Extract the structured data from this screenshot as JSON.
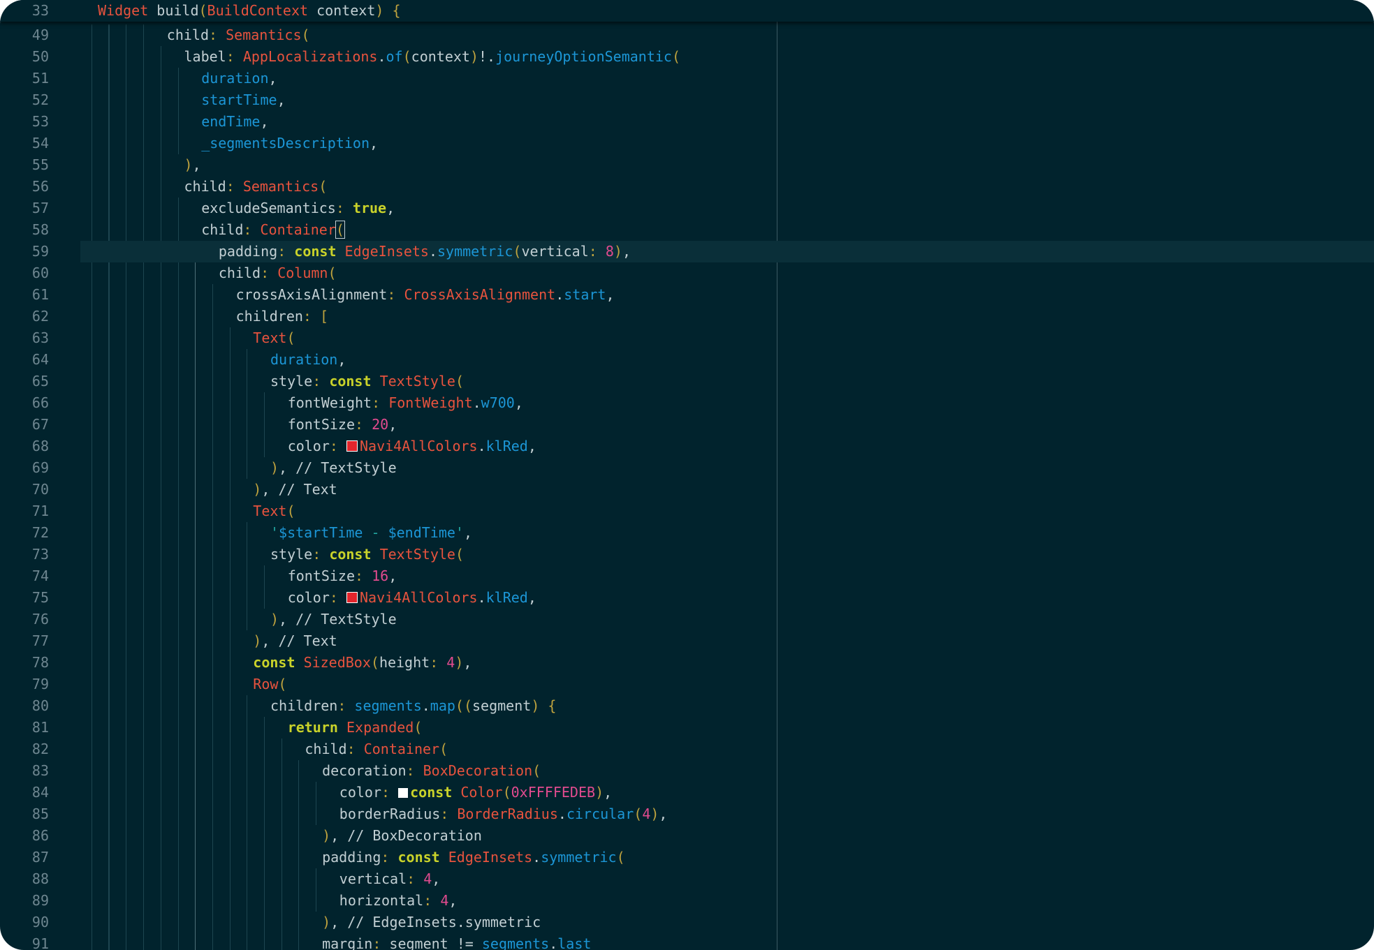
{
  "sticky_line": {
    "number": "33",
    "text": "Widget build(BuildContext context) {"
  },
  "lines": [
    {
      "n": "49",
      "text": "child: Semantics("
    },
    {
      "n": "50",
      "text": "label: AppLocalizations.of(context)!.journeyOptionSemantic("
    },
    {
      "n": "51",
      "text": "duration,"
    },
    {
      "n": "52",
      "text": "startTime,"
    },
    {
      "n": "53",
      "text": "endTime,"
    },
    {
      "n": "54",
      "text": "_segmentsDescription,"
    },
    {
      "n": "55",
      "text": "),"
    },
    {
      "n": "56",
      "text": "child: Semantics("
    },
    {
      "n": "57",
      "text": "excludeSemantics: true,"
    },
    {
      "n": "58",
      "text": "child: Container("
    },
    {
      "n": "59",
      "text": "padding: const EdgeInsets.symmetric(vertical: 8),"
    },
    {
      "n": "60",
      "text": "child: Column("
    },
    {
      "n": "61",
      "text": "crossAxisAlignment: CrossAxisAlignment.start,"
    },
    {
      "n": "62",
      "text": "children: ["
    },
    {
      "n": "63",
      "text": "Text("
    },
    {
      "n": "64",
      "text": "duration,"
    },
    {
      "n": "65",
      "text": "style: const TextStyle("
    },
    {
      "n": "66",
      "text": "fontWeight: FontWeight.w700,"
    },
    {
      "n": "67",
      "text": "fontSize: 20,"
    },
    {
      "n": "68",
      "text": "color: Navi4AllColors.klRed,"
    },
    {
      "n": "69",
      "text": "), // TextStyle"
    },
    {
      "n": "70",
      "text": "), // Text"
    },
    {
      "n": "71",
      "text": "Text("
    },
    {
      "n": "72",
      "text": "'$startTime - $endTime',"
    },
    {
      "n": "73",
      "text": "style: const TextStyle("
    },
    {
      "n": "74",
      "text": "fontSize: 16,"
    },
    {
      "n": "75",
      "text": "color: Navi4AllColors.klRed,"
    },
    {
      "n": "76",
      "text": "), // TextStyle"
    },
    {
      "n": "77",
      "text": "), // Text"
    },
    {
      "n": "78",
      "text": "const SizedBox(height: 4),"
    },
    {
      "n": "79",
      "text": "Row("
    },
    {
      "n": "80",
      "text": "children: segments.map((segment) {"
    },
    {
      "n": "81",
      "text": "return Expanded("
    },
    {
      "n": "82",
      "text": "child: Container("
    },
    {
      "n": "83",
      "text": "decoration: BoxDecoration("
    },
    {
      "n": "84",
      "text": "color: const Color(0xFFFFEDEB),"
    },
    {
      "n": "85",
      "text": "borderRadius: BorderRadius.circular(4),"
    },
    {
      "n": "86",
      "text": "), // BoxDecoration"
    },
    {
      "n": "87",
      "text": "padding: const EdgeInsets.symmetric("
    },
    {
      "n": "88",
      "text": "vertical: 4,"
    },
    {
      "n": "89",
      "text": "horizontal: 4,"
    },
    {
      "n": "90",
      "text": "), // EdgeInsets.symmetric"
    },
    {
      "n": "91",
      "text": "margin: segment != segments.last"
    }
  ],
  "swatches": {
    "line_68": {
      "color": "#e3252c"
    },
    "line_75": {
      "color": "#e3252c"
    },
    "line_84": {
      "color": "#ffffff"
    }
  },
  "theme": {
    "background": "#01232d",
    "keyword": "#c9d22a",
    "type": "#e8533e",
    "member": "#1c96d6",
    "punctuation": "#bfa33e",
    "number": "#e24b8f",
    "string": "#22a6a0",
    "plain": "#c2cfd3",
    "line_number": "#6e8690"
  }
}
